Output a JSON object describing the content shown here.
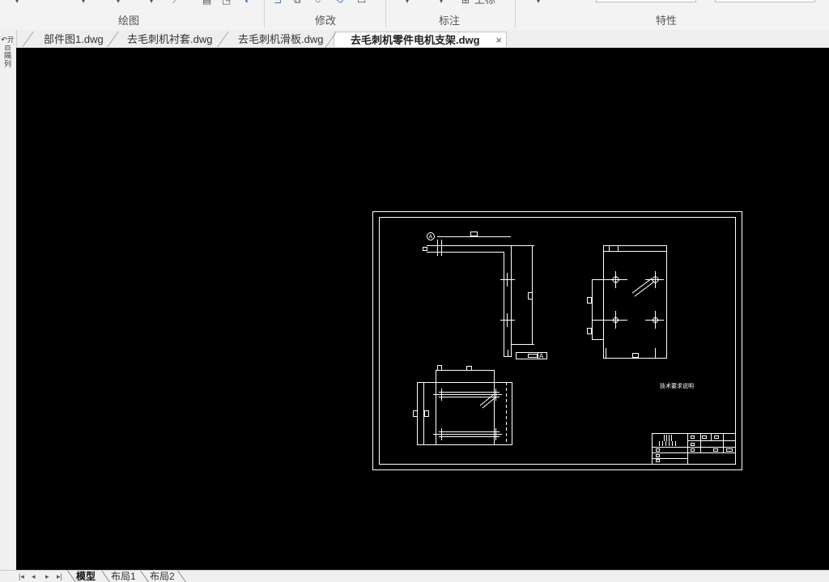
{
  "ribbon": {
    "groups": [
      {
        "label": "绘图"
      },
      {
        "label": "修改"
      },
      {
        "label": "标注"
      },
      {
        "label": "特性"
      }
    ],
    "partial_label": "上标"
  },
  "tabs": [
    {
      "label": "部件图1.dwg",
      "active": false
    },
    {
      "label": "去毛刺机衬套.dwg",
      "active": false
    },
    {
      "label": "去毛刺机滑板.dwg",
      "active": false
    },
    {
      "label": "去毛刺机零件电机支架.dwg",
      "active": true
    }
  ],
  "tab_close": "×",
  "left_toolbar": {
    "icons": [
      "↶亓",
      "⊟",
      "隔",
      "列"
    ]
  },
  "drawing": {
    "datum_label": "A",
    "datum_ref": "A",
    "tech_note": "技术要求说明"
  },
  "layout_tabs": [
    {
      "label": "模型",
      "active": true
    },
    {
      "label": "布局1",
      "active": false
    },
    {
      "label": "布局2",
      "active": false
    }
  ],
  "nav_buttons": [
    "|◂",
    "◂",
    "▸",
    "▸|"
  ],
  "colors": {
    "canvas": "#000000",
    "lines": "#ffffff",
    "ribbon": "#f3f3f3"
  }
}
